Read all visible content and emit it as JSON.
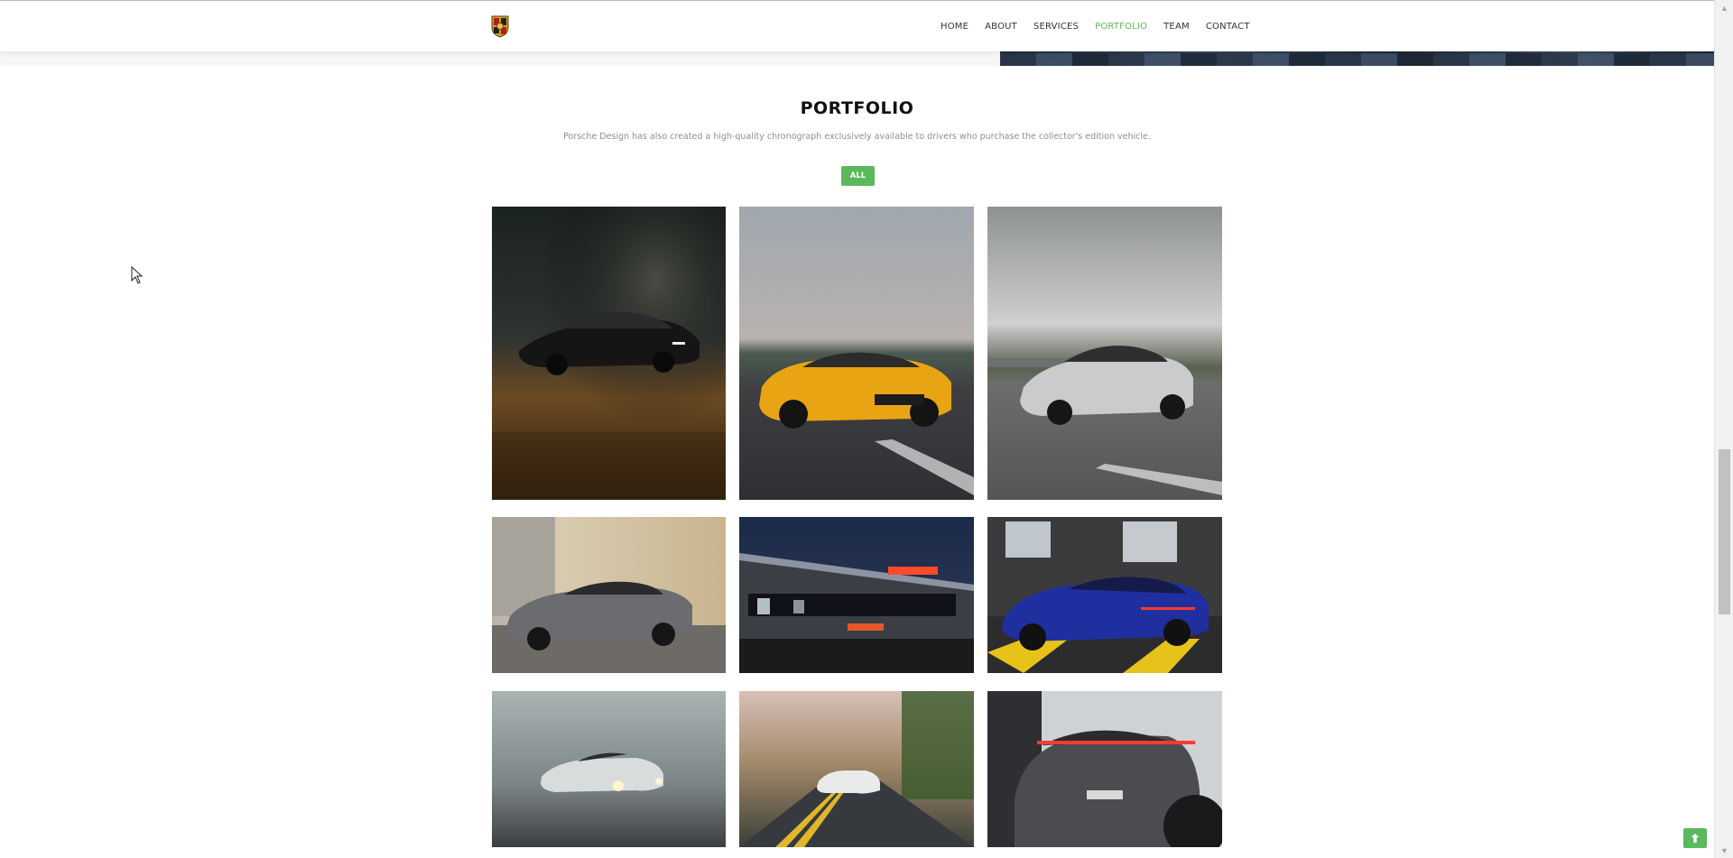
{
  "header": {
    "logo_icon": "porsche-crest-icon",
    "nav": [
      {
        "label": "HOME",
        "active": false
      },
      {
        "label": "ABOUT",
        "active": false
      },
      {
        "label": "SERVICES",
        "active": false
      },
      {
        "label": "PORTFOLIO",
        "active": true
      },
      {
        "label": "TEAM",
        "active": false
      },
      {
        "label": "CONTACT",
        "active": false
      }
    ]
  },
  "portfolio": {
    "title": "PORTFOLIO",
    "subtitle": "Porsche Design has also created a high-quality chronograph exclusively available to drivers who purchase the collector's edition vehicle.",
    "filter_label": "ALL",
    "items": [
      "black porsche taycan on dry grass",
      "yellow porsche boxster on road",
      "silver porsche 911 turbo",
      "grey porsche cayman by garage",
      "porsche dealership at night",
      "blue porsche 911 in parking",
      "white porsche 911 in fog",
      "white porsche gt3 on country road",
      "grey porsche 911 rear view"
    ]
  },
  "colors": {
    "accent": "#5cb85c",
    "text": "#333333",
    "muted": "#8e8e8e"
  },
  "widgets": {
    "back_to_top_icon": "arrow-up-icon",
    "cursor_icon": "mouse-pointer-icon"
  }
}
